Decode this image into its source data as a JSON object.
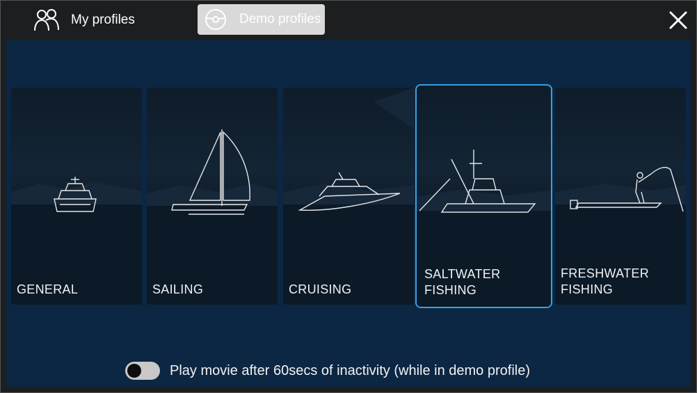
{
  "header": {
    "my_profiles_label": "My profiles",
    "demo_profiles_label": "Demo profiles"
  },
  "profiles": [
    {
      "label": "GENERAL"
    },
    {
      "label": "SAILING"
    },
    {
      "label": "CRUISING"
    },
    {
      "label": "SALTWATER\nFISHING",
      "selected": true
    },
    {
      "label": "FRESHWATER\nFISHING"
    }
  ],
  "footer": {
    "toggle_on": false,
    "text": "Play movie after 60secs of inactivity (while in demo profile)"
  },
  "colors": {
    "panel_bg": "#0c2743",
    "selected_border": "#3aa0e6",
    "demo_tab_bg": "#d9d9d9"
  }
}
